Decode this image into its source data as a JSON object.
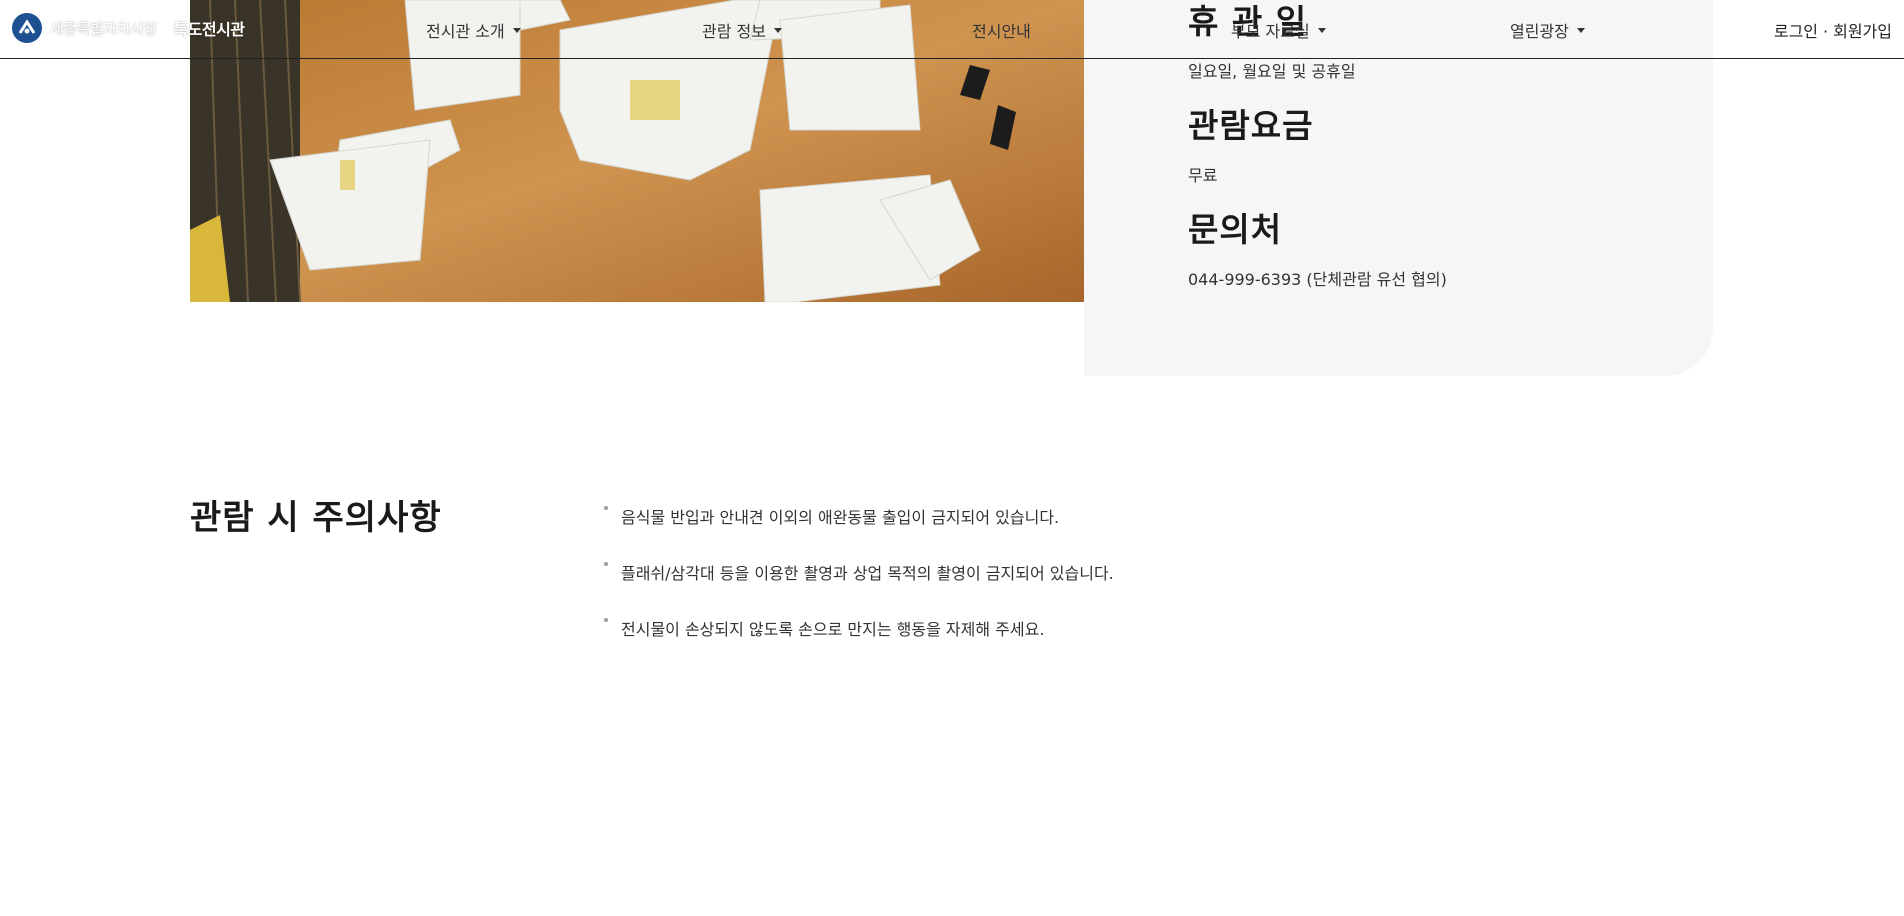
{
  "header": {
    "logo_org": "세종특별자치시청",
    "logo_name": "특도전시관",
    "nav": [
      {
        "label": "전시관 소개"
      },
      {
        "label": "관람 정보"
      },
      {
        "label": "전시안내"
      },
      {
        "label": "부모 자료실"
      },
      {
        "label": "열린광장"
      }
    ],
    "login": "로그인",
    "separator": "·",
    "signup": "회원가입"
  },
  "hero": {
    "photo_icon": "exhibition-hall-photo"
  },
  "info": {
    "closed_title": "휴 관 일",
    "closed_text": "일요일, 월요일 및 공휴일",
    "fee_title": "관람요금",
    "fee_text": "무료",
    "contact_title": "문의처",
    "contact_text": "044-999-6393 (단체관람 유선 협의)"
  },
  "notice": {
    "title": "관람 시 주의사항",
    "items": [
      "음식물 반입과 안내견 이외의 애완동물 출입이 금지되어 있습니다.",
      "플래쉬/삼각대 등을 이용한 촬영과 상업 목적의 촬영이 금지되어 있습니다.",
      "전시물이 손상되지 않도록 손으로 만지는 행동을 자제해 주세요."
    ]
  },
  "colors": {
    "panel_bg": "#f6f6f6",
    "logo_blue": "#1d4f91"
  }
}
